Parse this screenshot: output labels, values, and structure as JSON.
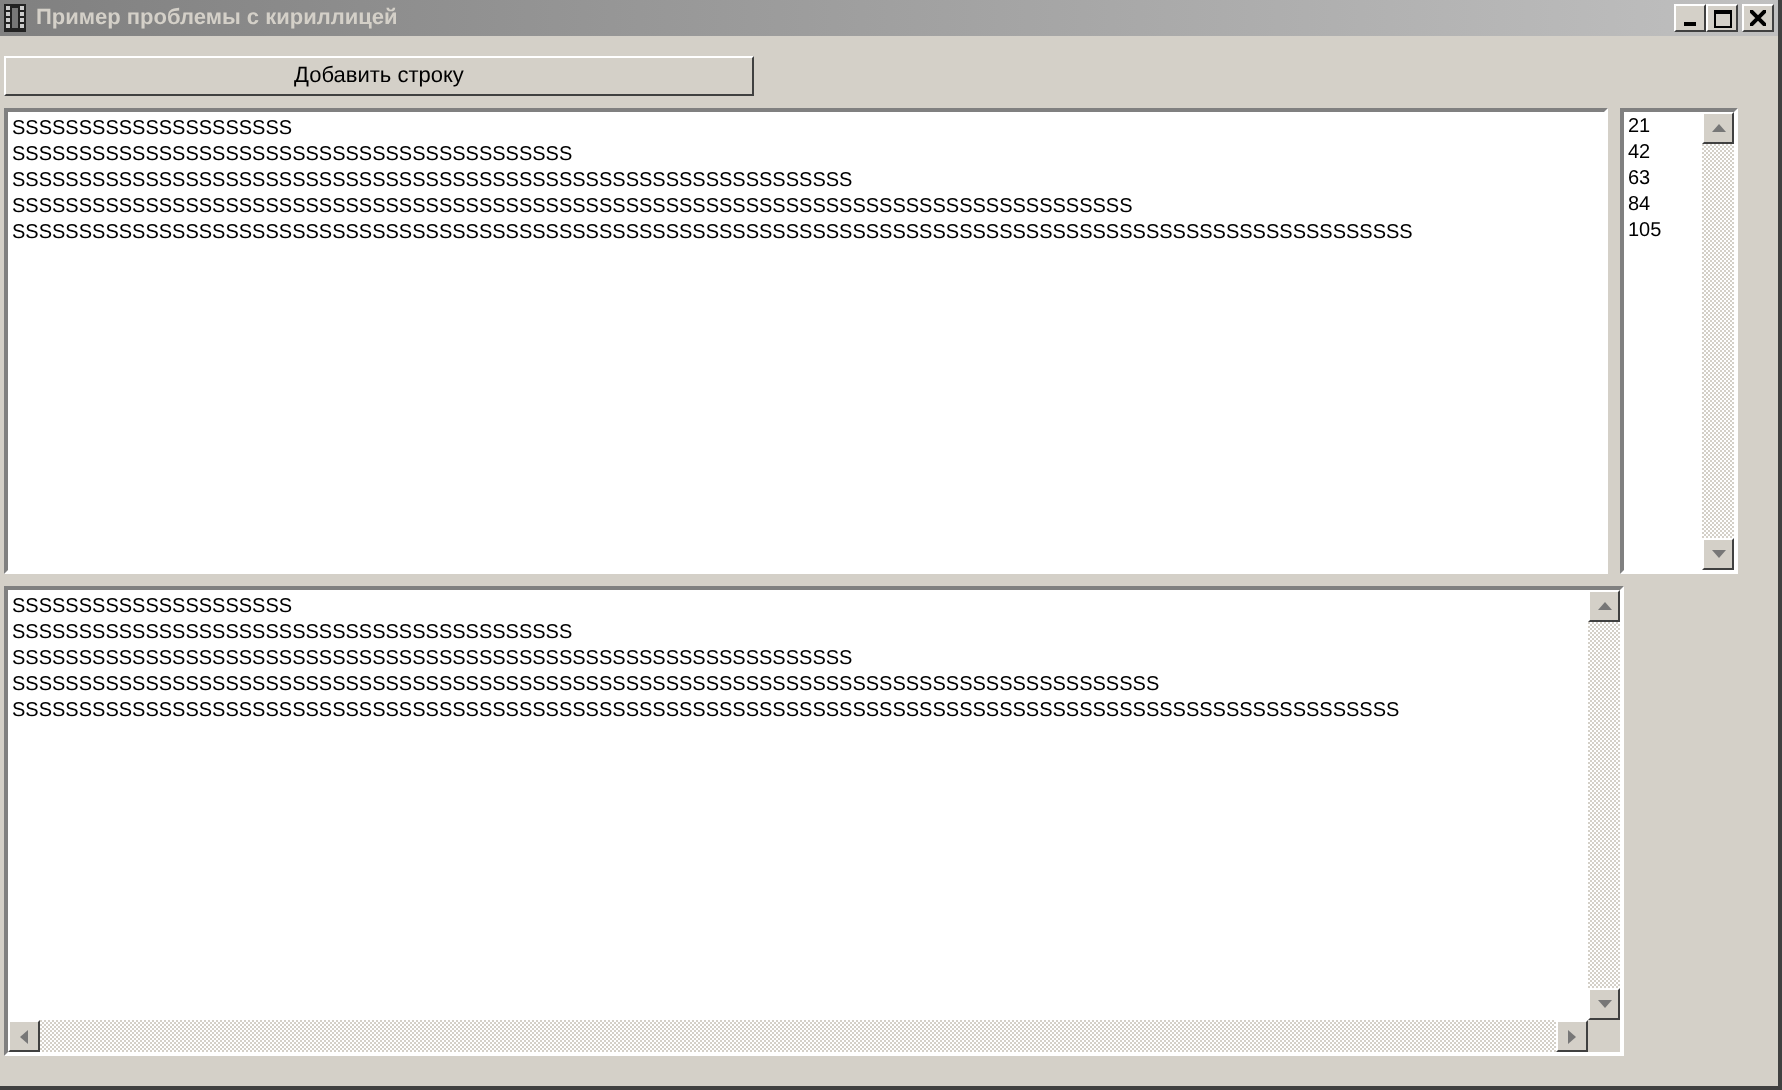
{
  "window": {
    "title": "Пример проблемы с кириллицей"
  },
  "add_button": {
    "label": "Добавить строку"
  },
  "top_memo": {
    "lines": [
      "SSSSSSSSSSSSSSSSSSSSS",
      "SSSSSSSSSSSSSSSSSSSSSSSSSSSSSSSSSSSSSSSSSS",
      "SSSSSSSSSSSSSSSSSSSSSSSSSSSSSSSSSSSSSSSSSSSSSSSSSSSSSSSSSSSSSSS",
      "SSSSSSSSSSSSSSSSSSSSSSSSSSSSSSSSSSSSSSSSSSSSSSSSSSSSSSSSSSSSSSSSSSSSSSSSSSSSSSSSSSSS",
      "SSSSSSSSSSSSSSSSSSSSSSSSSSSSSSSSSSSSSSSSSSSSSSSSSSSSSSSSSSSSSSSSSSSSSSSSSSSSSSSSSSSSSSSSSSSSSSSSSSSSSSSSS"
    ]
  },
  "length_list": {
    "items": [
      "21",
      "42",
      "63",
      "84",
      "105"
    ]
  },
  "bottom_memo": {
    "lines": [
      "SSSSSSSSSSSSSSSSSSSSS",
      "SSSSSSSSSSSSSSSSSSSSSSSSSSSSSSSSSSSSSSSSSS",
      "SSSSSSSSSSSSSSSSSSSSSSSSSSSSSSSSSSSSSSSSSSSSSSSSSSSSSSSSSSSSSSS",
      "SSSSSSSSSSSSSSSSSSSSSSSSSSSSSSSSSSSSSSSSSSSSSSSSSSSSSSSSSSSSSSSSSSSSSSSSSSSSSSSSSSSSSS",
      "SSSSSSSSSSSSSSSSSSSSSSSSSSSSSSSSSSSSSSSSSSSSSSSSSSSSSSSSSSSSSSSSSSSSSSSSSSSSSSSSSSSSSSSSSSSSSSSSSSSSSSSS"
    ]
  }
}
